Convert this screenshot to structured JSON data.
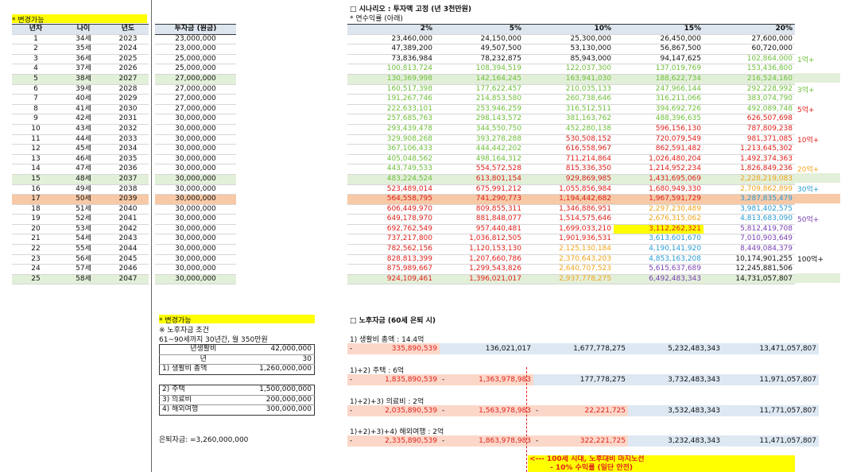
{
  "left_note": "* 변경가능",
  "left_headers": [
    "년차",
    "나이",
    "년도"
  ],
  "invest_header": "투자금 (원금)",
  "rows": [
    {
      "n": "1",
      "age": "34세",
      "year": "2023",
      "inv": "23,000,000",
      "s": ""
    },
    {
      "n": "2",
      "age": "35세",
      "year": "2024",
      "inv": "23,000,000",
      "s": ""
    },
    {
      "n": "3",
      "age": "36세",
      "year": "2025",
      "inv": "25,000,000",
      "s": ""
    },
    {
      "n": "4",
      "age": "37세",
      "year": "2026",
      "inv": "25,000,000",
      "s": ""
    },
    {
      "n": "5",
      "age": "38세",
      "year": "2027",
      "inv": "27,000,000",
      "s": "g"
    },
    {
      "n": "6",
      "age": "39세",
      "year": "2028",
      "inv": "27,000,000",
      "s": ""
    },
    {
      "n": "7",
      "age": "40세",
      "year": "2029",
      "inv": "27,000,000",
      "s": ""
    },
    {
      "n": "8",
      "age": "41세",
      "year": "2030",
      "inv": "27,000,000",
      "s": ""
    },
    {
      "n": "9",
      "age": "42세",
      "year": "2031",
      "inv": "30,000,000",
      "s": ""
    },
    {
      "n": "10",
      "age": "43세",
      "year": "2032",
      "inv": "30,000,000",
      "s": ""
    },
    {
      "n": "11",
      "age": "44세",
      "year": "2033",
      "inv": "30,000,000",
      "s": ""
    },
    {
      "n": "12",
      "age": "45세",
      "year": "2034",
      "inv": "30,000,000",
      "s": ""
    },
    {
      "n": "13",
      "age": "46세",
      "year": "2035",
      "inv": "30,000,000",
      "s": ""
    },
    {
      "n": "14",
      "age": "47세",
      "year": "2036",
      "inv": "30,000,000",
      "s": ""
    },
    {
      "n": "15",
      "age": "48세",
      "year": "2037",
      "inv": "30,000,000",
      "s": "g"
    },
    {
      "n": "16",
      "age": "49세",
      "year": "2038",
      "inv": "30,000,000",
      "s": ""
    },
    {
      "n": "17",
      "age": "50세",
      "year": "2039",
      "inv": "30,000,000",
      "s": "o"
    },
    {
      "n": "18",
      "age": "51세",
      "year": "2040",
      "inv": "30,000,000",
      "s": ""
    },
    {
      "n": "19",
      "age": "52세",
      "year": "2041",
      "inv": "30,000,000",
      "s": ""
    },
    {
      "n": "20",
      "age": "53세",
      "year": "2042",
      "inv": "30,000,000",
      "s": ""
    },
    {
      "n": "21",
      "age": "54세",
      "year": "2043",
      "inv": "30,000,000",
      "s": ""
    },
    {
      "n": "22",
      "age": "55세",
      "year": "2044",
      "inv": "30,000,000",
      "s": ""
    },
    {
      "n": "23",
      "age": "56세",
      "year": "2045",
      "inv": "30,000,000",
      "s": ""
    },
    {
      "n": "24",
      "age": "57세",
      "year": "2046",
      "inv": "30,000,000",
      "s": ""
    },
    {
      "n": "25",
      "age": "58세",
      "year": "2047",
      "inv": "30,000,000",
      "s": "g"
    }
  ],
  "scenario_title": "□ 시나리오 : 투자액 고정 (년 3천만원)",
  "scenario_sub": "* 연수익률 (아래)",
  "rate_headers": [
    "2%",
    "5%",
    "10%",
    "15%",
    "20%"
  ],
  "grid": [
    [
      "23,460,000",
      "24,150,000",
      "25,300,000",
      "26,450,000",
      "27,600,000"
    ],
    [
      "47,389,200",
      "49,507,500",
      "53,130,000",
      "56,867,500",
      "60,720,000"
    ],
    [
      "73,836,984",
      "78,232,875",
      "85,943,000",
      "94,147,625",
      "102,864,000"
    ],
    [
      "100,813,724",
      "108,394,519",
      "122,037,300",
      "137,019,769",
      "153,436,800"
    ],
    [
      "130,369,998",
      "142,164,245",
      "163,941,030",
      "188,622,734",
      "216,524,160"
    ],
    [
      "160,517,398",
      "177,622,457",
      "210,035,133",
      "247,966,144",
      "292,228,992"
    ],
    [
      "191,267,746",
      "214,853,580",
      "260,738,646",
      "316,211,066",
      "383,074,790"
    ],
    [
      "222,633,101",
      "253,946,259",
      "316,512,511",
      "394,692,726",
      "492,089,748"
    ],
    [
      "257,685,763",
      "298,143,572",
      "381,163,762",
      "488,396,635",
      "626,507,698"
    ],
    [
      "293,439,478",
      "344,550,750",
      "452,280,138",
      "596,156,130",
      "787,809,238"
    ],
    [
      "329,908,268",
      "393,278,288",
      "530,508,152",
      "720,079,549",
      "981,371,085"
    ],
    [
      "367,106,433",
      "444,442,202",
      "616,558,967",
      "862,591,482",
      "1,213,645,302"
    ],
    [
      "405,048,562",
      "498,164,312",
      "711,214,864",
      "1,026,480,204",
      "1,492,374,363"
    ],
    [
      "443,749,533",
      "554,572,528",
      "815,336,350",
      "1,214,952,234",
      "1,826,849,236"
    ],
    [
      "483,224,524",
      "613,801,154",
      "929,869,985",
      "1,431,695,069",
      "2,228,219,083"
    ],
    [
      "523,489,014",
      "675,991,212",
      "1,055,856,984",
      "1,680,949,330",
      "2,709,862,899"
    ],
    [
      "564,558,795",
      "741,290,773",
      "1,194,442,682",
      "1,967,591,729",
      "3,287,835,479"
    ],
    [
      "606,449,970",
      "809,855,311",
      "1,346,886,951",
      "2,297,230,489",
      "3,981,402,575"
    ],
    [
      "649,178,970",
      "881,848,077",
      "1,514,575,646",
      "2,676,315,062",
      "4,813,683,090"
    ],
    [
      "692,762,549",
      "957,440,481",
      "1,699,033,210",
      "3,112,262,321",
      "5,812,419,708"
    ],
    [
      "737,217,800",
      "1,036,812,505",
      "1,901,936,531",
      "3,613,601,670",
      "7,010,903,649"
    ],
    [
      "782,562,156",
      "1,120,153,130",
      "2,125,130,184",
      "4,190,141,920",
      "8,449,084,379"
    ],
    [
      "828,813,399",
      "1,207,660,786",
      "2,370,643,203",
      "4,853,163,208",
      "10,174,901,255"
    ],
    [
      "875,989,667",
      "1,299,543,826",
      "2,640,707,523",
      "5,615,637,689",
      "12,245,881,506"
    ],
    [
      "924,109,461",
      "1,396,021,017",
      "2,937,778,275",
      "6,492,483,343",
      "14,731,057,807"
    ]
  ],
  "side_marks": [
    "1억+",
    "3억+",
    "5억+",
    "10억+",
    "20억+",
    "30억+",
    "50억+",
    "100억+"
  ],
  "pension": {
    "note": "* 변경가능",
    "cond": "※ 노후자금 조건",
    "period": "61~90세까지 30년간, 월 350만원",
    "rows": [
      [
        "년생활비",
        "42,000,000"
      ],
      [
        "년",
        "30"
      ],
      [
        "1) 생활비 총액",
        "1,260,000,000"
      ],
      [
        "2) 주택",
        "1,500,000,000"
      ],
      [
        "3) 의료비",
        "200,000,000"
      ],
      [
        "4) 해외여행",
        "300,000,000"
      ]
    ],
    "total": "은퇴자금: =3,260,000,000"
  },
  "retire": {
    "title": "□ 노후자금 (60세 은퇴 시)",
    "blocks": [
      {
        "label": "1) 생활비 총액 : 14.4억",
        "vals": [
          "-",
          "335,890,539",
          "136,021,017",
          "1,677,778,275",
          "5,232,483,343",
          "13,471,057,807"
        ]
      },
      {
        "label": "1)+2) 주택 : 6억",
        "vals": [
          "-",
          "1,835,890,539",
          "-",
          "1,363,978,983",
          "177,778,275",
          "3,732,483,343",
          "11,971,057,807"
        ]
      },
      {
        "label": "1)+2)+3) 의료비 : 2억",
        "vals": [
          "-",
          "2,035,890,539",
          "-",
          "1,563,978,983",
          "-",
          "22,221,725",
          "3,532,483,343",
          "11,771,057,807"
        ]
      },
      {
        "label": "1)+2)+3)+4) 해외여행 : 2억",
        "vals": [
          "-",
          "2,335,890,539",
          "-",
          "1,863,978,983",
          "-",
          "322,221,725",
          "3,232,483,343",
          "11,471,057,807"
        ]
      }
    ],
    "banner1": "<--- 100세 시대, 노후대비 마지노선",
    "banner2": "- 10% 수익률 (일단 안전)"
  }
}
